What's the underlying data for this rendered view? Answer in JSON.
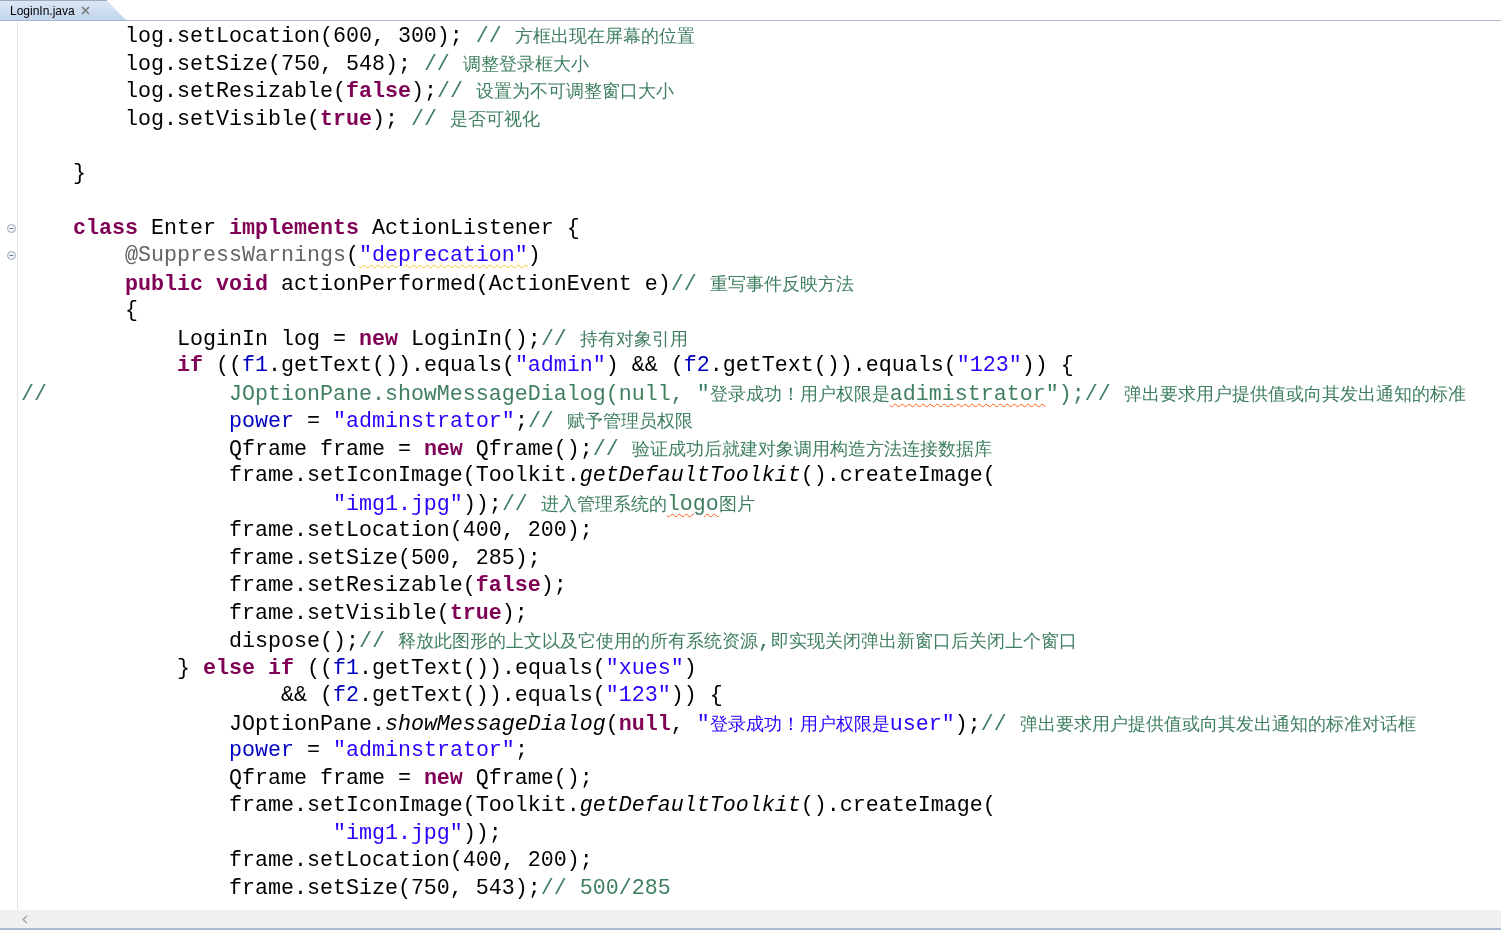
{
  "tab": {
    "title": "LoginIn.java",
    "selected": true
  },
  "lines": [
    {
      "tokens": [
        {
          "kind": "plain",
          "text": "        log.setLocation(600, 300); "
        },
        {
          "kind": "comment",
          "text": "// 方框出现在屏幕的位置"
        }
      ]
    },
    {
      "tokens": [
        {
          "kind": "plain",
          "text": "        log.setSize(750, 548); "
        },
        {
          "kind": "comment",
          "text": "// 调整登录框大小"
        }
      ]
    },
    {
      "tokens": [
        {
          "kind": "plain",
          "text": "        log.setResizable("
        },
        {
          "kind": "keyword",
          "text": "false"
        },
        {
          "kind": "plain",
          "text": ");"
        },
        {
          "kind": "comment",
          "text": "// 设置为不可调整窗口大小"
        }
      ]
    },
    {
      "tokens": [
        {
          "kind": "plain",
          "text": "        log.setVisible("
        },
        {
          "kind": "keyword",
          "text": "true"
        },
        {
          "kind": "plain",
          "text": "); "
        },
        {
          "kind": "comment",
          "text": "// 是否可视化"
        }
      ]
    },
    {
      "blank_line_before": true,
      "tokens": [
        {
          "kind": "plain",
          "text": "    }"
        }
      ]
    },
    {
      "blank_line_before": true,
      "collapsible": true,
      "tokens": [
        {
          "kind": "keyword",
          "text": "    class"
        },
        {
          "kind": "plain",
          "text": " Enter "
        },
        {
          "kind": "keyword",
          "text": "implements"
        },
        {
          "kind": "plain",
          "text": " ActionListener {"
        }
      ]
    },
    {
      "collapsible": true,
      "tokens": [
        {
          "kind": "annotation",
          "text": "        @SuppressWarnings"
        },
        {
          "kind": "plain",
          "text": "("
        },
        {
          "kind": "string",
          "text": "\"deprecation\"",
          "warning": true
        },
        {
          "kind": "plain",
          "text": ")"
        }
      ]
    },
    {
      "tokens": [
        {
          "kind": "keyword",
          "text": "        public"
        },
        {
          "kind": "keyword",
          "text": " void"
        },
        {
          "kind": "plain",
          "text": " actionPerformed(ActionEvent e)"
        },
        {
          "kind": "comment",
          "text": "// 重写事件反映方法"
        }
      ]
    },
    {
      "tokens": [
        {
          "kind": "plain",
          "text": "        {"
        }
      ]
    },
    {
      "tokens": [
        {
          "kind": "plain",
          "text": "            LoginIn log = "
        },
        {
          "kind": "keyword",
          "text": "new"
        },
        {
          "kind": "plain",
          "text": " LoginIn();"
        },
        {
          "kind": "comment",
          "text": "// 持有对象引用"
        }
      ]
    },
    {
      "tokens": [
        {
          "kind": "keyword",
          "text": "            if"
        },
        {
          "kind": "plain",
          "text": " (("
        },
        {
          "kind": "field",
          "text": "f1"
        },
        {
          "kind": "plain",
          "text": ".getText()).equals("
        },
        {
          "kind": "string",
          "text": "\"admin\""
        },
        {
          "kind": "plain",
          "text": ") && ("
        },
        {
          "kind": "field",
          "text": "f2"
        },
        {
          "kind": "plain",
          "text": ".getText()).equals("
        },
        {
          "kind": "string",
          "text": "\"123\""
        },
        {
          "kind": "plain",
          "text": ")) {"
        }
      ]
    },
    {
      "tokens": [
        {
          "kind": "comment",
          "text": "//              JOptionPane.showMessageDialog(null, \"登录成功！用户权限是"
        },
        {
          "kind": "comment",
          "text": "adimistrator",
          "misspelled": true
        },
        {
          "kind": "comment",
          "text": "\");// 弹出要求用户提供值或向其发出通知的标准"
        }
      ]
    },
    {
      "tokens": [
        {
          "kind": "field",
          "text": "                power"
        },
        {
          "kind": "plain",
          "text": " = "
        },
        {
          "kind": "string",
          "text": "\"adminstrator\""
        },
        {
          "kind": "plain",
          "text": ";"
        },
        {
          "kind": "comment",
          "text": "// 赋予管理员权限"
        }
      ]
    },
    {
      "tokens": [
        {
          "kind": "plain",
          "text": "                Qframe frame = "
        },
        {
          "kind": "keyword",
          "text": "new"
        },
        {
          "kind": "plain",
          "text": " Qframe();"
        },
        {
          "kind": "comment",
          "text": "// 验证成功后就建对象调用构造方法连接数据库"
        }
      ]
    },
    {
      "tokens": [
        {
          "kind": "plain",
          "text": "                frame.setIconImage(Toolkit."
        },
        {
          "kind": "static",
          "text": "getDefaultToolkit"
        },
        {
          "kind": "plain",
          "text": "().createImage("
        }
      ]
    },
    {
      "tokens": [
        {
          "kind": "string",
          "text": "                        \"img1.jpg\""
        },
        {
          "kind": "plain",
          "text": "));"
        },
        {
          "kind": "comment",
          "text": "// 进入管理系统的"
        },
        {
          "kind": "comment",
          "text": "logo",
          "misspelled": true
        },
        {
          "kind": "comment",
          "text": "图片"
        }
      ]
    },
    {
      "tokens": [
        {
          "kind": "plain",
          "text": "                frame.setLocation(400, 200);"
        }
      ]
    },
    {
      "tokens": [
        {
          "kind": "plain",
          "text": "                frame.setSize(500, 285);"
        }
      ]
    },
    {
      "tokens": [
        {
          "kind": "plain",
          "text": "                frame.setResizable("
        },
        {
          "kind": "keyword",
          "text": "false"
        },
        {
          "kind": "plain",
          "text": ");"
        }
      ]
    },
    {
      "tokens": [
        {
          "kind": "plain",
          "text": "                frame.setVisible("
        },
        {
          "kind": "keyword",
          "text": "true"
        },
        {
          "kind": "plain",
          "text": ");"
        }
      ]
    },
    {
      "tokens": [
        {
          "kind": "plain",
          "text": "                dispose();"
        },
        {
          "kind": "comment",
          "text": "// 释放此图形的上文以及它使用的所有系统资源,即实现关闭弹出新窗口后关闭上个窗口"
        }
      ]
    },
    {
      "tokens": [
        {
          "kind": "plain",
          "text": "            } "
        },
        {
          "kind": "keyword",
          "text": "else"
        },
        {
          "kind": "keyword",
          "text": " if"
        },
        {
          "kind": "plain",
          "text": " (("
        },
        {
          "kind": "field",
          "text": "f1"
        },
        {
          "kind": "plain",
          "text": ".getText()).equals("
        },
        {
          "kind": "string",
          "text": "\"xues\""
        },
        {
          "kind": "plain",
          "text": ")"
        }
      ]
    },
    {
      "tokens": [
        {
          "kind": "plain",
          "text": "                    && ("
        },
        {
          "kind": "field",
          "text": "f2"
        },
        {
          "kind": "plain",
          "text": ".getText()).equals("
        },
        {
          "kind": "string",
          "text": "\"123\""
        },
        {
          "kind": "plain",
          "text": ")) {"
        }
      ]
    },
    {
      "tokens": [
        {
          "kind": "plain",
          "text": "                JOptionPane."
        },
        {
          "kind": "static",
          "text": "showMessageDialog"
        },
        {
          "kind": "plain",
          "text": "("
        },
        {
          "kind": "keyword",
          "text": "null"
        },
        {
          "kind": "plain",
          "text": ", "
        },
        {
          "kind": "string",
          "text": "\"登录成功！用户权限是user\""
        },
        {
          "kind": "plain",
          "text": ");"
        },
        {
          "kind": "comment",
          "text": "// 弹出要求用户提供值或向其发出通知的标准对话框"
        }
      ]
    },
    {
      "tokens": [
        {
          "kind": "field",
          "text": "                power"
        },
        {
          "kind": "plain",
          "text": " = "
        },
        {
          "kind": "string",
          "text": "\"adminstrator\""
        },
        {
          "kind": "plain",
          "text": ";"
        }
      ]
    },
    {
      "tokens": [
        {
          "kind": "plain",
          "text": "                Qframe frame = "
        },
        {
          "kind": "keyword",
          "text": "new"
        },
        {
          "kind": "plain",
          "text": " Qframe();"
        }
      ]
    },
    {
      "tokens": [
        {
          "kind": "plain",
          "text": "                frame.setIconImage(Toolkit."
        },
        {
          "kind": "static",
          "text": "getDefaultToolkit"
        },
        {
          "kind": "plain",
          "text": "().createImage("
        }
      ]
    },
    {
      "tokens": [
        {
          "kind": "string",
          "text": "                        \"img1.jpg\""
        },
        {
          "kind": "plain",
          "text": "));"
        }
      ]
    },
    {
      "tokens": [
        {
          "kind": "plain",
          "text": "                frame.setLocation(400, 200);"
        }
      ]
    },
    {
      "tokens": [
        {
          "kind": "plain",
          "text": "                frame.setSize(750, 543);"
        },
        {
          "kind": "comment",
          "text": "// 500/285"
        }
      ]
    }
  ]
}
